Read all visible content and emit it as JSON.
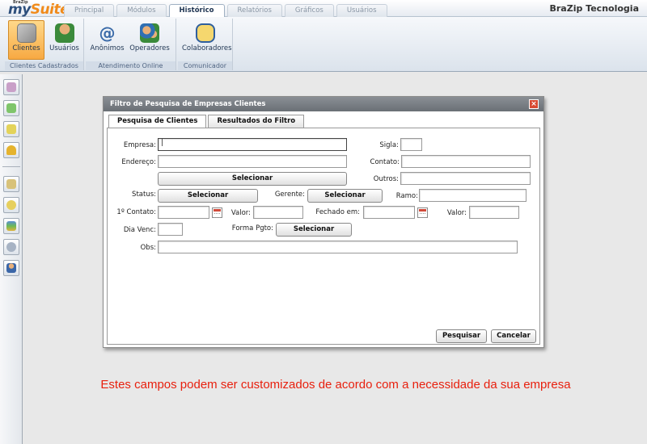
{
  "app": {
    "logo_small": "BraZip",
    "logo_my": "my",
    "logo_suite": "Suite",
    "brand": "BraZip Tecnologia"
  },
  "tabs": [
    "Principal",
    "Módulos",
    "Histórico",
    "Relatórios",
    "Gráficos",
    "Usuários"
  ],
  "active_tab": "Histórico",
  "ribbon": {
    "groups": [
      {
        "label": "Clientes Cadastrados",
        "buttons": [
          "Clientes",
          "Usuários"
        ]
      },
      {
        "label": "Atendimento Online",
        "buttons": [
          "Anônimos",
          "Operadores"
        ]
      },
      {
        "label": "Comunicador",
        "buttons": [
          "Colaboradores"
        ]
      }
    ]
  },
  "dialog": {
    "title": "Filtro de Pesquisa de Empresas Clientes",
    "close": "×",
    "tabs": [
      "Pesquisa de Clientes",
      "Resultados do Filtro"
    ],
    "labels": {
      "empresa": "Empresa:",
      "sigla": "Sigla:",
      "endereco": "Endereço:",
      "contato": "Contato:",
      "outros": "Outros:",
      "status": "Status:",
      "gerente": "Gerente:",
      "ramo": "Ramo:",
      "primeiro_contato": "1º Contato:",
      "valor1": "Valor:",
      "fechado_em": "Fechado em:",
      "valor2": "Valor:",
      "dia_venc": "Dia Venc:",
      "forma_pgto": "Forma Pgto:",
      "obs": "Obs:"
    },
    "values": {
      "empresa": "|",
      "sigla": "",
      "endereco": "",
      "contato": "",
      "outros": "",
      "ramo": "",
      "primeiro_contato": "",
      "valor1": "",
      "fechado_em": "",
      "valor2": "",
      "dia_venc": "",
      "obs": ""
    },
    "select_label": "Selecionar",
    "buttons": {
      "search": "Pesquisar",
      "cancel": "Cancelar"
    }
  },
  "caption": "Estes campos podem ser customizados de acordo com a necessidade da sua empresa"
}
